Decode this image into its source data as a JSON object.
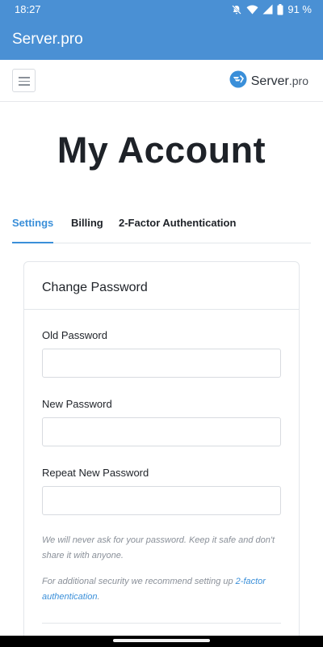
{
  "status_bar": {
    "time": "18:27",
    "battery": "91 %",
    "icons": [
      "bell-off-icon",
      "wifi-icon",
      "signal-icon",
      "battery-icon"
    ]
  },
  "app_bar": {
    "title": "Server.pro"
  },
  "site_header": {
    "logo_text": "Server",
    "logo_suffix": ".pro",
    "menu_icon": "hamburger-menu-icon"
  },
  "page": {
    "title": "My Account"
  },
  "tabs": [
    {
      "label": "Settings",
      "active": true
    },
    {
      "label": "Billing",
      "active": false
    },
    {
      "label": "2-Factor Authentication",
      "active": false
    }
  ],
  "card": {
    "title": "Change Password",
    "fields": [
      {
        "label": "Old Password",
        "value": "",
        "placeholder": ""
      },
      {
        "label": "New Password",
        "value": "",
        "placeholder": ""
      },
      {
        "label": "Repeat New Password",
        "value": "",
        "placeholder": ""
      }
    ],
    "note_1": "We will never ask for your password. Keep it safe and don't share it with anyone.",
    "note_2_prefix": "For additional security we recommend setting up ",
    "note_2_link": "2-factor authentication",
    "note_2_suffix": "."
  },
  "colors": {
    "app_bar": "#4a90d4",
    "accent": "#3a8fd9",
    "text": "#1e2228",
    "muted": "#8a9099"
  }
}
